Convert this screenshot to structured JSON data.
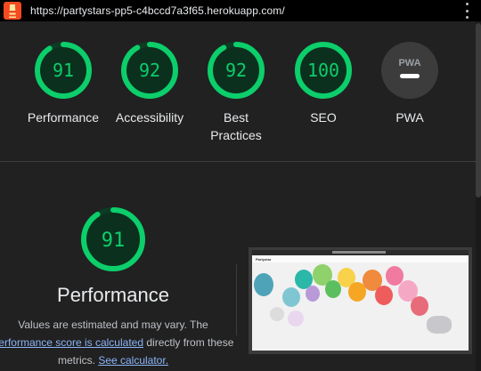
{
  "url": "https://partystars-pp5-c4bccd7a3f65.herokuapp.com/",
  "colors": {
    "good": "#0cce6b",
    "good_track": "#0d3b24",
    "pwa_gray": "#3c3c3c",
    "link": "#8ab4f8"
  },
  "categories": [
    {
      "label": "Performance",
      "score": "91",
      "value": 91
    },
    {
      "label": "Accessibility",
      "score": "92",
      "value": 92
    },
    {
      "label": "Best Practices",
      "score": "92",
      "value": 92
    },
    {
      "label": "SEO",
      "score": "100",
      "value": 100
    },
    {
      "label": "PWA",
      "badge_text": "PWA",
      "icon": "pwa-badge-icon"
    }
  ],
  "performance": {
    "score": "91",
    "value": 91,
    "title": "Performance",
    "note_part1": "Values are estimated and may vary. The",
    "note_link1": "performance score is calculated",
    "note_part2": "directly from these metrics.",
    "note_link2": "See calculator."
  },
  "screenshot": {
    "site_logo": "Partystar"
  }
}
